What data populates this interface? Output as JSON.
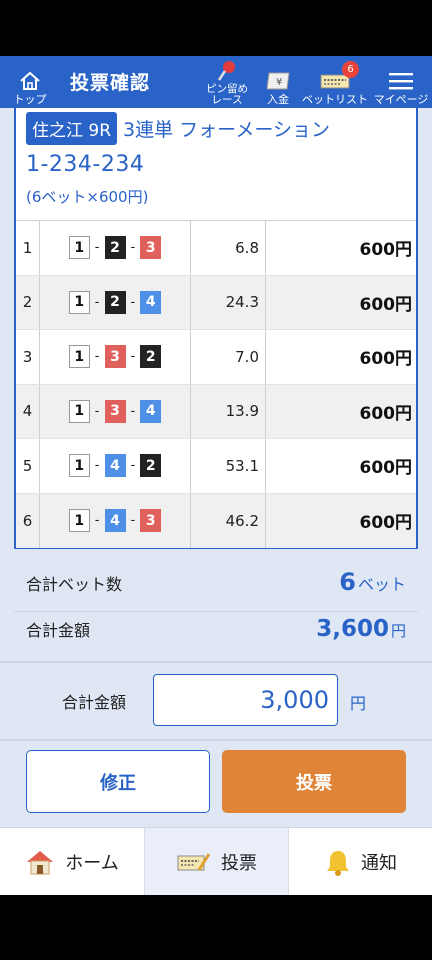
{
  "header": {
    "top_label": "トップ",
    "title": "投票確認",
    "pin_label": "ピン留め\nレース",
    "deposit_label": "入金",
    "betlist_label": "ベットリスト",
    "betlist_badge": "6",
    "mypage_label": "マイページ"
  },
  "bet": {
    "race": "住之江 9R",
    "type": "3連単 フォーメーション",
    "combo": "1-234-234",
    "summary": "(6ベット×600円)",
    "rows": [
      {
        "no": "1",
        "boats": [
          "1",
          "2",
          "3"
        ],
        "odds": "6.8",
        "amount": "600円"
      },
      {
        "no": "2",
        "boats": [
          "1",
          "2",
          "4"
        ],
        "odds": "24.3",
        "amount": "600円"
      },
      {
        "no": "3",
        "boats": [
          "1",
          "3",
          "2"
        ],
        "odds": "7.0",
        "amount": "600円"
      },
      {
        "no": "4",
        "boats": [
          "1",
          "3",
          "4"
        ],
        "odds": "13.9",
        "amount": "600円"
      },
      {
        "no": "5",
        "boats": [
          "1",
          "4",
          "2"
        ],
        "odds": "53.1",
        "amount": "600円"
      },
      {
        "no": "6",
        "boats": [
          "1",
          "4",
          "3"
        ],
        "odds": "46.2",
        "amount": "600円"
      }
    ]
  },
  "totals": {
    "bet_count_label": "合計ベット数",
    "bet_count": "6",
    "bet_unit": "ベット",
    "amount_label": "合計金額",
    "amount": "3,600",
    "amount_unit": "円"
  },
  "input": {
    "label": "合計金額",
    "value": "3,000",
    "unit": "円"
  },
  "buttons": {
    "fix": "修正",
    "vote": "投票"
  },
  "tabs": {
    "home": "ホーム",
    "vote": "投票",
    "notify": "通知"
  },
  "colors": {
    "primary": "#2a63c8",
    "vote_button": "#e08437",
    "boat_1": "#ffffff",
    "boat_2": "#222222",
    "boat_3": "#e0605c",
    "boat_4": "#4e8fe8"
  }
}
